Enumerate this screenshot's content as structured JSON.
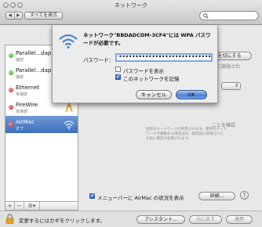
{
  "window": {
    "title": "ネットワーク",
    "back_label": "◀",
    "forward_label": "▶",
    "show_all_label": "すべてを表示",
    "search_placeholder": ""
  },
  "services": [
    {
      "name": "Parallel...dap",
      "status": "接続",
      "color": "#29a01a",
      "icon": "parallels-icon"
    },
    {
      "name": "Parallel...dap",
      "status": "接続",
      "color": "#29a01a",
      "icon": "parallels-icon"
    },
    {
      "name": "Ethernet",
      "status": "未接続",
      "color": "#d11a1a",
      "icon": "ethernet-icon"
    },
    {
      "name": "FireWire",
      "status": "未接続",
      "color": "#d11a1a",
      "icon": "firewire-icon"
    },
    {
      "name": "AirMac",
      "status": "オフ",
      "color": "#d11a1a",
      "icon": "wifi-icon",
      "selected": true
    }
  ],
  "list_controls": {
    "add": "+",
    "remove": "−",
    "action": "⚙▾"
  },
  "pane": {
    "turn_off_button": "を切にする",
    "connected_text": "ークに接続され",
    "confirm_text": "ことを確認",
    "dim_lines": [
      "接続のネットワークが利用されます。使用のネット",
      "ワークが複数ある場合はは、接続前に詳細された",
      "る前に確認が必要されます。"
    ],
    "menubar_checkbox_label": "メニューバーに AirMac の状況を表示",
    "menubar_checked": true,
    "advanced_button": "詳細...",
    "help_label": "?"
  },
  "bottom": {
    "lock_text": "変更するにはカギをクリックします。",
    "assistant_button": "アシスタント...",
    "revert_button": "元に戻す",
    "apply_button": "適用"
  },
  "sheet": {
    "title": "ネットワーク\"BBDADCDM-3CF4\"には WPA パスワードが必要です。",
    "password_label": "パスワード：",
    "password_value": "••••••••••••••••••••••••••••",
    "show_password_label": "パスワードを表示",
    "show_password_checked": false,
    "remember_label": "このネットワークを記憶",
    "remember_checked": true,
    "cancel_button": "キャンセル",
    "ok_button": "OK"
  },
  "colors": {
    "accent": "#3d6fbd",
    "ok_button": "#4d82d3"
  }
}
